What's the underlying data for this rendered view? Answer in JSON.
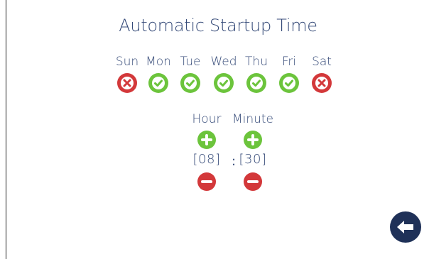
{
  "title": "Automatic Startup Time",
  "days": [
    {
      "label": "Sun",
      "enabled": false
    },
    {
      "label": "Mon",
      "enabled": true
    },
    {
      "label": "Tue",
      "enabled": true
    },
    {
      "label": "Wed",
      "enabled": true
    },
    {
      "label": "Thu",
      "enabled": true
    },
    {
      "label": "Fri",
      "enabled": true
    },
    {
      "label": "Sat",
      "enabled": false
    }
  ],
  "time": {
    "hour_label": "Hour",
    "minute_label": "Minute",
    "hour_value": "[08]",
    "minute_value": "[30]",
    "separator": ":"
  },
  "colors": {
    "text": "#354a78",
    "enabled": "#6cc43c",
    "disabled": "#d3383a",
    "back_button": "#1f3158"
  },
  "icons": {
    "enabled": "check-circle-icon",
    "disabled": "x-circle-icon",
    "increment": "plus-circle-icon",
    "decrement": "minus-circle-icon",
    "back": "arrow-left-circle-icon"
  }
}
